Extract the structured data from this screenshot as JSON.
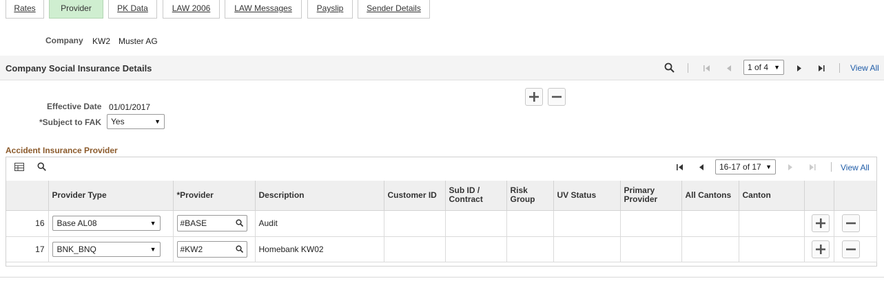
{
  "tabs": [
    {
      "label": "Rates",
      "active": false
    },
    {
      "label": "Provider",
      "active": true
    },
    {
      "label": "PK Data",
      "active": false
    },
    {
      "label": "LAW 2006",
      "active": false
    },
    {
      "label": "LAW Messages",
      "active": false
    },
    {
      "label": "Payslip",
      "active": false
    },
    {
      "label": "Sender Details",
      "active": false
    }
  ],
  "company": {
    "label": "Company",
    "code": "KW2",
    "name": "Muster AG"
  },
  "section": {
    "title": "Company Social Insurance Details",
    "pager": "1 of 4",
    "view_all": "View All"
  },
  "detail": {
    "effective_date_label": "Effective Date",
    "effective_date": "01/01/2017",
    "subject_fak_label": "*Subject to FAK",
    "subject_fak_value": "Yes"
  },
  "grid": {
    "title": "Accident Insurance Provider",
    "pager": "16-17 of 17",
    "view_all": "View All",
    "columns": [
      "",
      "Provider Type",
      "*Provider",
      "Description",
      "Customer ID",
      "Sub ID / Contract",
      "Risk Group",
      "UV Status",
      "Primary Provider",
      "All Cantons",
      "Canton",
      "",
      ""
    ],
    "rows": [
      {
        "num": "16",
        "provider_type": "Base AL08",
        "provider": "#BASE",
        "description": "Audit"
      },
      {
        "num": "17",
        "provider_type": "BNK_BNQ",
        "provider": "#KW2",
        "description": "Homebank KW02"
      }
    ]
  },
  "icons": {
    "add": "+",
    "remove": "−",
    "first": "⏮",
    "prev": "◀",
    "next": "▶",
    "last": "⏭"
  }
}
